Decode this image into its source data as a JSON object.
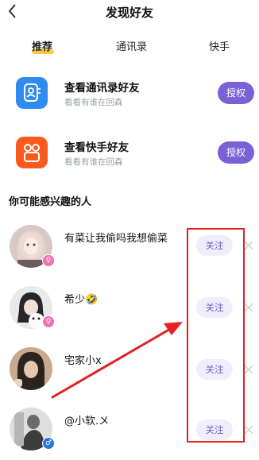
{
  "header": {
    "title": "发现好友"
  },
  "tabs": [
    {
      "label": "推荐",
      "active": true
    },
    {
      "label": "通讯录",
      "active": false
    },
    {
      "label": "快手",
      "active": false
    }
  ],
  "sources": [
    {
      "title": "查看通讯录好友",
      "subtitle": "看看有谁在回森",
      "button": "授权",
      "icon": "contacts-icon",
      "color": "#2e8bf0"
    },
    {
      "title": "查看快手好友",
      "subtitle": "看看有谁在回森",
      "button": "授权",
      "icon": "kuaishou-icon",
      "color": "#fb5a1e"
    }
  ],
  "section_title": "你可能感兴趣的人",
  "people": [
    {
      "name": "有菜让我偷吗我想偷菜",
      "gender": "female",
      "gender_symbol": "♀",
      "follow_label": "关注"
    },
    {
      "name": "希少🤣",
      "gender": "female",
      "gender_symbol": "♀",
      "follow_label": "关注"
    },
    {
      "name": "宅家小x",
      "gender": "none",
      "gender_symbol": "",
      "follow_label": "关注"
    },
    {
      "name": "@小软.〤",
      "gender": "male",
      "gender_symbol": "♂",
      "follow_label": "关注"
    }
  ],
  "colors": {
    "accent": "#7b61d6",
    "follow_bg": "#f1eefb",
    "tab_underline": "#f6cc3c",
    "annotation": "#e52020"
  }
}
